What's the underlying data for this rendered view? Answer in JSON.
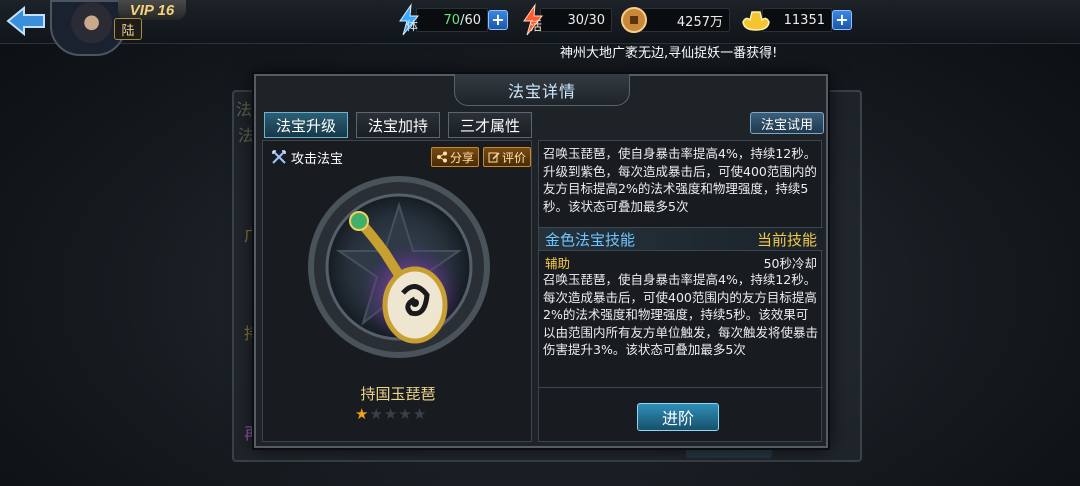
{
  "topbar": {
    "vip": "VIP 16",
    "server": "陆",
    "stamina": {
      "label": "体",
      "value": "70",
      "max": "/60"
    },
    "energy": {
      "label": "活",
      "value": "30",
      "max": "/30"
    },
    "coins": "4257万",
    "gold": "11351",
    "plus": "+"
  },
  "marquee": "神州大地广袤无边,寻仙捉妖一番获得!",
  "dialog": {
    "title": "法宝详情",
    "tabs": [
      "法宝升级",
      "法宝加持",
      "三才属性"
    ],
    "trial_button": "法宝试用",
    "left": {
      "type_label": "攻击法宝",
      "share_label": "分享",
      "review_label": "评价",
      "item_name": "持国玉琵琶",
      "stars_filled": 1,
      "stars_total": 5
    },
    "right": {
      "desc_top": "召唤玉琵琶，使自身暴击率提高4%，持续12秒。升级到紫色，每次造成暴击后，可使400范围内的友方目标提高2%的法术强度和物理强度，持续5秒。该状态可叠加最多5次",
      "section_title": "金色法宝技能",
      "section_state": "当前技能",
      "sub_left": "辅助",
      "sub_right": "50秒冷却",
      "desc_main": "召唤玉琵琶，使自身暴击率提高4%，持续12秒。每次造成暴击后，可使400范围内的友方目标提高2%的法术强度和物理强度，持续5秒。该效果可以由范围内所有友方单位触发，每次触发将使暴击伤害提升3%。该状态可叠加最多5次",
      "advance_button": "进阶"
    }
  },
  "colors": {
    "accent_blue": "#6fc5ff",
    "accent_gold": "#f3c94b",
    "stamina_green": "#6fe07a"
  },
  "icons": [
    "back-arrow-icon",
    "lightning-icon",
    "copper-coin-icon",
    "gold-ingot-icon",
    "crossed-swords-icon",
    "share-icon",
    "edit-icon",
    "star-icon"
  ]
}
